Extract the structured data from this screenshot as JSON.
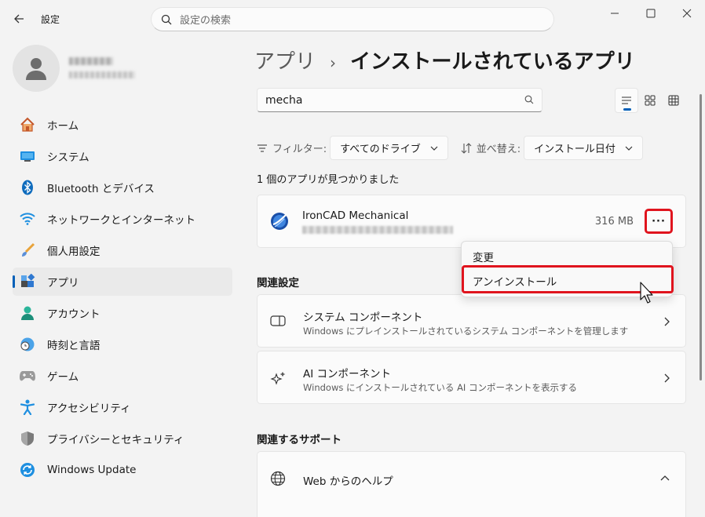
{
  "titlebar": {
    "app_title": "設定",
    "search_placeholder": "設定の検索"
  },
  "sidebar": {
    "items": [
      {
        "label": "ホーム",
        "icon": "home-icon"
      },
      {
        "label": "システム",
        "icon": "system-icon"
      },
      {
        "label": "Bluetooth とデバイス",
        "icon": "bluetooth-icon"
      },
      {
        "label": "ネットワークとインターネット",
        "icon": "wifi-icon"
      },
      {
        "label": "個人用設定",
        "icon": "brush-icon"
      },
      {
        "label": "アプリ",
        "icon": "apps-icon"
      },
      {
        "label": "アカウント",
        "icon": "account-icon"
      },
      {
        "label": "時刻と言語",
        "icon": "clock-globe-icon"
      },
      {
        "label": "ゲーム",
        "icon": "gamepad-icon"
      },
      {
        "label": "アクセシビリティ",
        "icon": "accessibility-icon"
      },
      {
        "label": "プライバシーとセキュリティ",
        "icon": "shield-icon"
      },
      {
        "label": "Windows Update",
        "icon": "update-icon"
      }
    ]
  },
  "main": {
    "breadcrumb_parent": "アプリ",
    "breadcrumb_sep": "›",
    "breadcrumb_current": "インストールされているアプリ",
    "filter_value": "mecha",
    "filter_label": "フィルター:",
    "filter_option": "すべてのドライブ",
    "sort_label": "並べ替え:",
    "sort_option": "インストール日付",
    "result_count": "1 個のアプリが見つかりました",
    "app": {
      "name": "IronCAD Mechanical",
      "size": "316 MB",
      "more": "···"
    },
    "context_menu": {
      "modify": "変更",
      "uninstall": "アンインストール"
    },
    "related_settings_title": "関連設定",
    "related": [
      {
        "title": "システム コンポーネント",
        "desc": "Windows にプレインストールされているシステム コンポーネントを管理します"
      },
      {
        "title": "AI コンポーネント",
        "desc": "Windows にインストールされている AI コンポーネントを表示する"
      }
    ],
    "support_title": "関連するサポート",
    "support_item": "Web からのヘルプ"
  },
  "colors": {
    "accent": "#005fb8",
    "highlight_red": "#e0141e"
  }
}
